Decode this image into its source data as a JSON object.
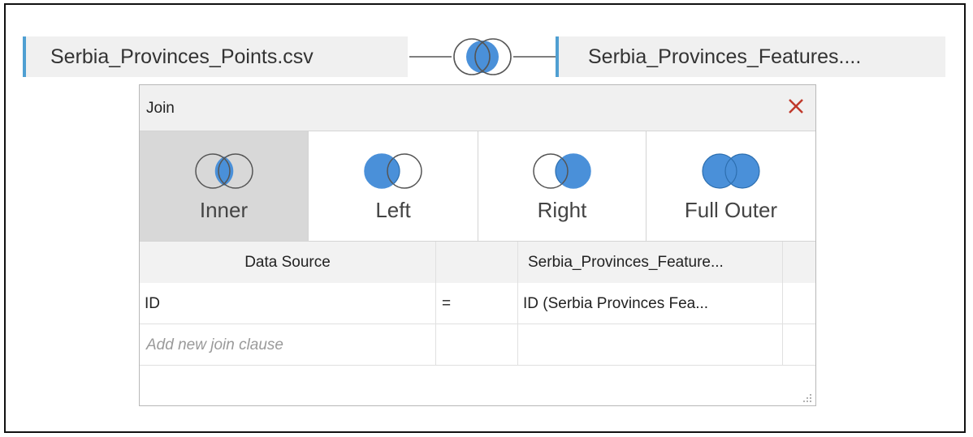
{
  "top_bar": {
    "left_source": "Serbia_Provinces_Points.csv",
    "right_source": "Serbia_Provinces_Features....",
    "join_icon": "inner-join-icon"
  },
  "dialog": {
    "title": "Join",
    "close_icon": "close-icon",
    "join_types": [
      {
        "label": "Inner",
        "icon": "inner-join-icon",
        "selected": true
      },
      {
        "label": "Left",
        "icon": "left-join-icon",
        "selected": false
      },
      {
        "label": "Right",
        "icon": "right-join-icon",
        "selected": false
      },
      {
        "label": "Full Outer",
        "icon": "full-outer-join-icon",
        "selected": false
      }
    ],
    "columns": {
      "left": "Data Source",
      "right": "Serbia_Provinces_Feature..."
    },
    "clauses": [
      {
        "left": "ID",
        "operator": "=",
        "right": "ID (Serbia Provinces Fea..."
      }
    ],
    "add_clause_placeholder": "Add new join clause"
  },
  "colors": {
    "accent": "#4f9fd2",
    "venn_fill": "#4a90d9",
    "close": "#c0392b",
    "selected_bg": "#d8d8d8"
  }
}
